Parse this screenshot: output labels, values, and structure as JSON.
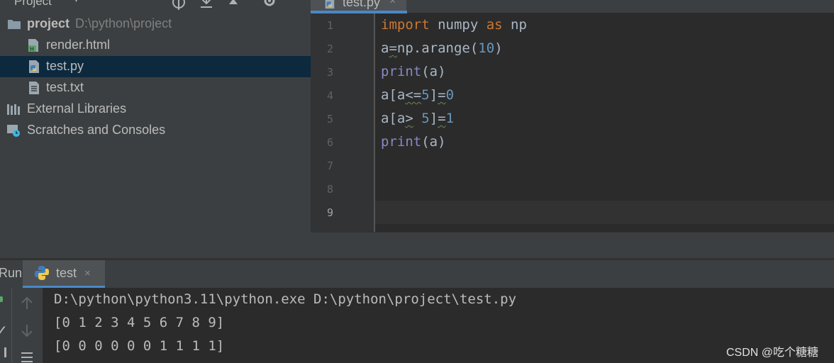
{
  "project_panel": {
    "title": "Project",
    "tree": [
      {
        "label": "project",
        "path": "D:\\python\\project",
        "icon": "folder-icon"
      },
      {
        "label": "render.html",
        "icon": "html-file-icon"
      },
      {
        "label": "test.py",
        "icon": "python-file-icon",
        "selected": true
      },
      {
        "label": "test.txt",
        "icon": "text-file-icon"
      },
      {
        "label": "External Libraries",
        "icon": "libraries-icon"
      },
      {
        "label": "Scratches and Consoles",
        "icon": "scratches-icon"
      }
    ]
  },
  "editor": {
    "tab": {
      "label": "test.py",
      "close": "×"
    },
    "line_numbers": [
      "1",
      "2",
      "3",
      "4",
      "5",
      "6",
      "7",
      "8",
      "9"
    ],
    "active_line": 9
  },
  "run_panel": {
    "label": "Run:",
    "tab": {
      "label": "test",
      "close": "×"
    },
    "console": [
      "D:\\python\\python3.11\\python.exe D:\\python\\project\\test.py",
      "[0 1 2 3 4 5 6 7 8 9]",
      "[0 0 0 0 0 0 1 1 1 1]"
    ]
  },
  "watermark": "CSDN @吃个糖糖",
  "colors": {
    "panel_bg": "#3c3f41",
    "editor_bg": "#2b2b2b",
    "selection": "#0d293e",
    "keyword": "#cc7832",
    "builtin": "#8888c6",
    "number": "#6897bb",
    "accent": "#4a88c7"
  }
}
